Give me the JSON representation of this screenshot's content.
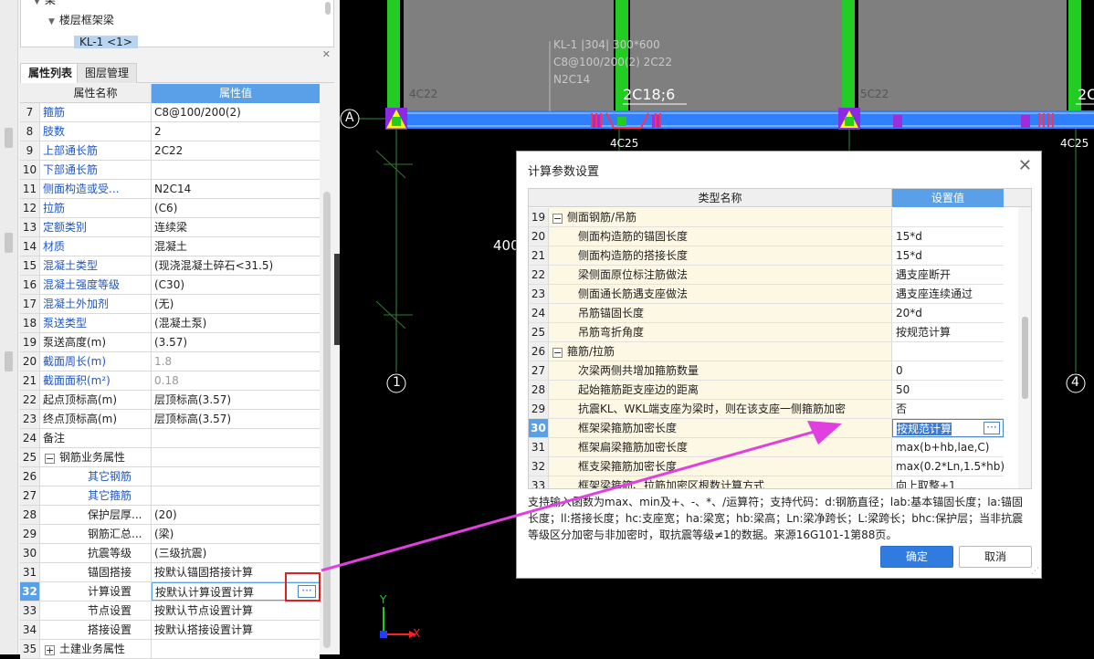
{
  "tree": {
    "items": [
      {
        "label": "梁",
        "indent": 1
      },
      {
        "label": "楼层框架梁",
        "indent": 2
      },
      {
        "label": "KL-1 <1>",
        "indent": 3
      }
    ]
  },
  "tabs": [
    {
      "label": "属性列表",
      "active": true
    },
    {
      "label": "图层管理",
      "active": false
    }
  ],
  "prop_table": {
    "col_name": "属性名称",
    "col_value": "属性值",
    "rows": [
      {
        "num": "7",
        "name": "箍筋",
        "value": "C8@100/200(2)",
        "blue": true
      },
      {
        "num": "8",
        "name": "肢数",
        "value": "2",
        "blue": true
      },
      {
        "num": "9",
        "name": "上部通长筋",
        "value": "2C22",
        "blue": true
      },
      {
        "num": "10",
        "name": "下部通长筋",
        "value": "",
        "blue": true
      },
      {
        "num": "11",
        "name": "侧面构造或受...",
        "value": "N2C14",
        "blue": true
      },
      {
        "num": "12",
        "name": "拉筋",
        "value": "(C6)",
        "blue": true
      },
      {
        "num": "13",
        "name": "定额类别",
        "value": "连续梁",
        "blue": true
      },
      {
        "num": "14",
        "name": "材质",
        "value": "混凝土",
        "blue": true
      },
      {
        "num": "15",
        "name": "混凝土类型",
        "value": "(现浇混凝土碎石<31.5)",
        "blue": true
      },
      {
        "num": "16",
        "name": "混凝土强度等级",
        "value": "(C30)",
        "blue": true
      },
      {
        "num": "17",
        "name": "混凝土外加剂",
        "value": "(无)",
        "blue": true
      },
      {
        "num": "18",
        "name": "泵送类型",
        "value": "(混凝土泵)",
        "blue": true
      },
      {
        "num": "19",
        "name": "泵送高度(m)",
        "value": "(3.57)",
        "blue": false
      },
      {
        "num": "20",
        "name": "截面周长(m)",
        "value": "1.8",
        "blue": true,
        "gray": true
      },
      {
        "num": "21",
        "name": "截面面积(m²)",
        "value": "0.18",
        "blue": true,
        "gray": true
      },
      {
        "num": "22",
        "name": "起点顶标高(m)",
        "value": "层顶标高(3.57)",
        "blue": false
      },
      {
        "num": "23",
        "name": "终点顶标高(m)",
        "value": "层顶标高(3.57)",
        "blue": false
      },
      {
        "num": "24",
        "name": "备注",
        "value": "",
        "blue": false
      },
      {
        "num": "25",
        "name": "钢筋业务属性",
        "value": "",
        "group": true,
        "toggle": "−"
      },
      {
        "num": "26",
        "name": "其它钢筋",
        "value": "",
        "blue": true,
        "sub": true
      },
      {
        "num": "27",
        "name": "其它箍筋",
        "value": "",
        "blue": true,
        "sub": true
      },
      {
        "num": "28",
        "name": "保护层厚...",
        "value": "(20)",
        "sub": true
      },
      {
        "num": "29",
        "name": "钢筋汇总...",
        "value": "(梁)",
        "sub": true
      },
      {
        "num": "30",
        "name": "抗震等级",
        "value": "(三级抗震)",
        "sub": true
      },
      {
        "num": "31",
        "name": "锚固搭接",
        "value": "按默认锚固搭接计算",
        "sub": true
      },
      {
        "num": "32",
        "name": "计算设置",
        "value": "按默认计算设置计算",
        "sub": true,
        "selected": true
      },
      {
        "num": "33",
        "name": "节点设置",
        "value": "按默认节点设置计算",
        "sub": true
      },
      {
        "num": "34",
        "name": "搭接设置",
        "value": "按默认搭接设置计算",
        "sub": true
      },
      {
        "num": "35",
        "name": "土建业务属性",
        "value": "",
        "group": true,
        "toggle": "+"
      }
    ]
  },
  "cad": {
    "beam_label_lines": [
      "KL-1 |304| 300*600",
      "C8@100/200(2) 2C22",
      "N2C14"
    ],
    "labels": {
      "c1": "4C22",
      "c2": "5C22",
      "top1": "2C18;6",
      "top2": "2C",
      "bot1": "4C25",
      "bot2": "4C25",
      "dim": "400",
      "axisA": "A",
      "axis1": "1",
      "axis4": "4",
      "ucs_x": "X",
      "ucs_y": "Y"
    }
  },
  "dialog": {
    "title": "计算参数设置",
    "col_name": "类型名称",
    "col_value": "设置值",
    "rows": [
      {
        "num": "19",
        "name": "侧面钢筋/吊筋",
        "value": "",
        "group": true
      },
      {
        "num": "20",
        "name": "侧面构造筋的锚固长度",
        "value": "15*d"
      },
      {
        "num": "21",
        "name": "侧面构造筋的搭接长度",
        "value": "15*d"
      },
      {
        "num": "22",
        "name": "梁侧面原位标注筋做法",
        "value": "遇支座断开"
      },
      {
        "num": "23",
        "name": "侧面通长筋遇支座做法",
        "value": "遇支座连续通过"
      },
      {
        "num": "24",
        "name": "吊筋锚固长度",
        "value": "20*d"
      },
      {
        "num": "25",
        "name": "吊筋弯折角度",
        "value": "按规范计算"
      },
      {
        "num": "26",
        "name": "箍筋/拉筋",
        "value": "",
        "group": true
      },
      {
        "num": "27",
        "name": "次梁两侧共增加箍筋数量",
        "value": "0"
      },
      {
        "num": "28",
        "name": "起始箍筋距支座边的距离",
        "value": "50"
      },
      {
        "num": "29",
        "name": "抗震KL、WKL端支座为梁时，则在该支座一侧箍筋加密",
        "value": "否"
      },
      {
        "num": "30",
        "name": "框架梁箍筋加密长度",
        "value": "按规范计算",
        "selected": true
      },
      {
        "num": "31",
        "name": "框架扁梁箍筋加密长度",
        "value": "max(b+hb,lae,C)"
      },
      {
        "num": "32",
        "name": "框支梁箍筋加密长度",
        "value": "max(0.2*Ln,1.5*hb)"
      },
      {
        "num": "33",
        "name": "框架梁箍筋、拉筋加密区根数计算方式",
        "value": "向上取整+1"
      }
    ],
    "help_text": "支持输入函数为max、min及+、-、*、/运算符；支持代码：d:钢筋直径；lab:基本锚固长度；la:锚固长度；ll:搭接长度；hc:支座宽；ha:梁宽；hb:梁高；Ln:梁净跨长；L:梁跨长；bhc:保护层；当非抗震等级区分加密与非加密时，取抗震等级≠1的数据。来源16G101-1第88页。",
    "ok_label": "确定",
    "cancel_label": "取消"
  },
  "colors": {
    "accent": "#5aa0e8",
    "column_green": "#22cc22",
    "beam_blue": "#2f7fff",
    "arrow_magenta": "#e040e0",
    "highlight_red": "#e02020"
  }
}
